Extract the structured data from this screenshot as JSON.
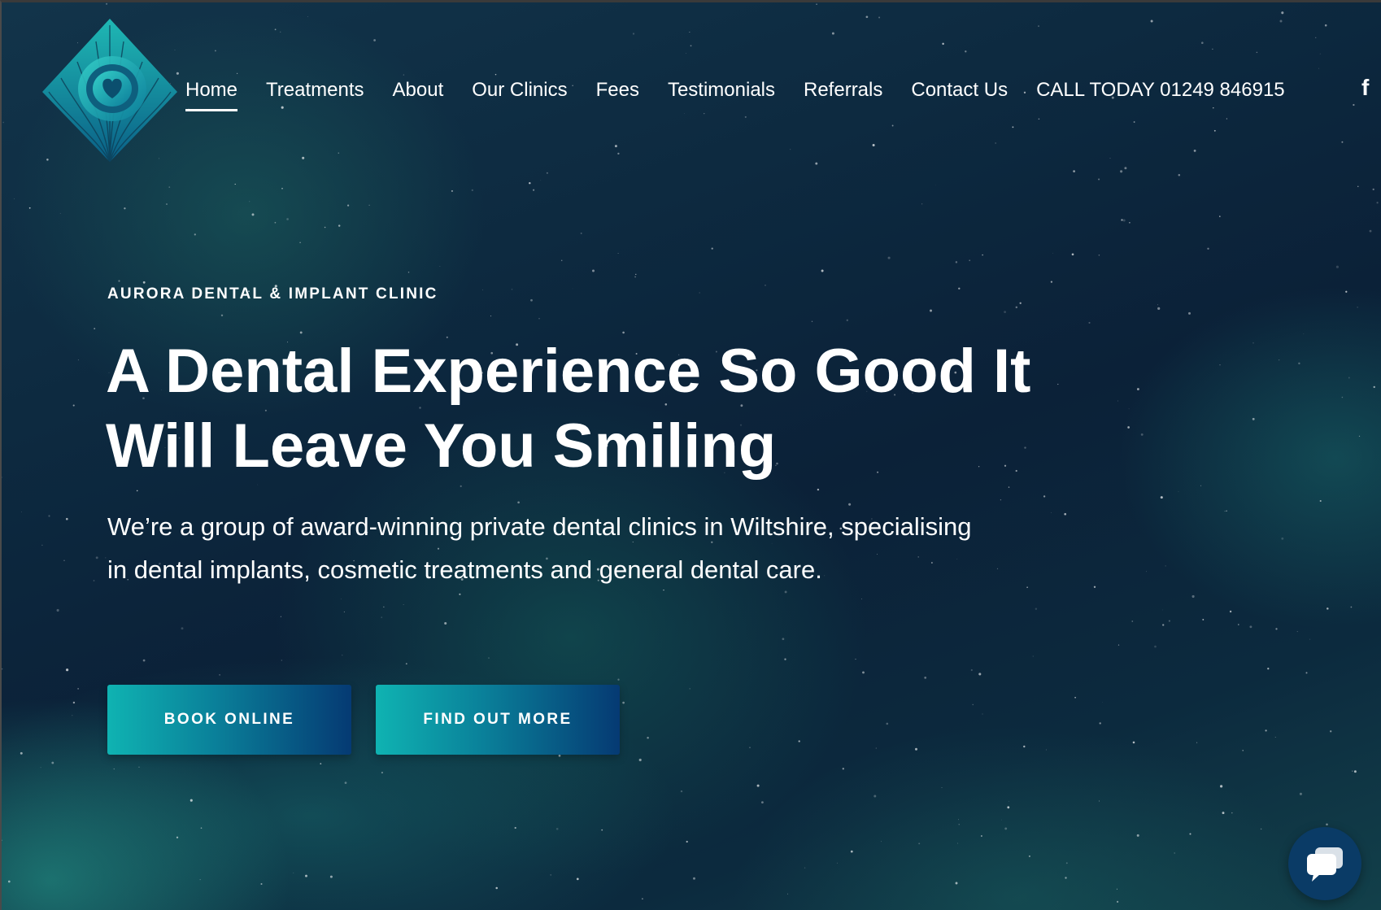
{
  "brand": {
    "logo_icon": "peacock-feather-diamond-logo",
    "accent_color": "#14b5b0",
    "dark_color": "#0a3b66"
  },
  "nav": {
    "items": [
      {
        "label": "Home",
        "active": true
      },
      {
        "label": "Treatments",
        "active": false
      },
      {
        "label": "About",
        "active": false
      },
      {
        "label": "Our Clinics",
        "active": false
      },
      {
        "label": "Fees",
        "active": false
      },
      {
        "label": "Testimonials",
        "active": false
      },
      {
        "label": "Referrals",
        "active": false
      },
      {
        "label": "Contact Us",
        "active": false
      }
    ],
    "call_label": "CALL TODAY 01249 846915",
    "social_icon": "facebook-icon",
    "social_glyph": "f"
  },
  "hero": {
    "eyebrow": "AURORA DENTAL & IMPLANT CLINIC",
    "headline": "A Dental Experience So Good It Will Leave You Smiling",
    "lead": "We’re a group of award-winning private dental clinics in Wiltshire, specialising in dental implants, cosmetic treatments and general dental care.",
    "buttons": {
      "book": "BOOK ONLINE",
      "more": "FIND OUT MORE"
    }
  },
  "chat_widget": {
    "icon": "chat-bubbles-icon"
  }
}
